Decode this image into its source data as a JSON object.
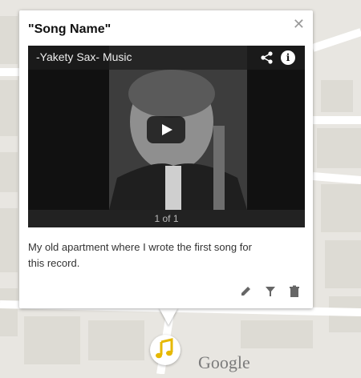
{
  "popup": {
    "title": "\"Song Name\"",
    "close_icon": "close-icon",
    "video": {
      "title": "-Yakety Sax- Music",
      "counter": "1 of 1",
      "icons": [
        "share-icon",
        "info-icon",
        "play-icon"
      ]
    },
    "description": "My old apartment where I wrote the first song for this record.",
    "actions": [
      "edit-icon",
      "style-icon",
      "delete-icon"
    ]
  },
  "map": {
    "marker_icon": "music-note-icon",
    "logo": "Google",
    "colors": {
      "background": "#e8e6e1",
      "roads": "#ffffff",
      "marker": "#e6b800"
    }
  }
}
